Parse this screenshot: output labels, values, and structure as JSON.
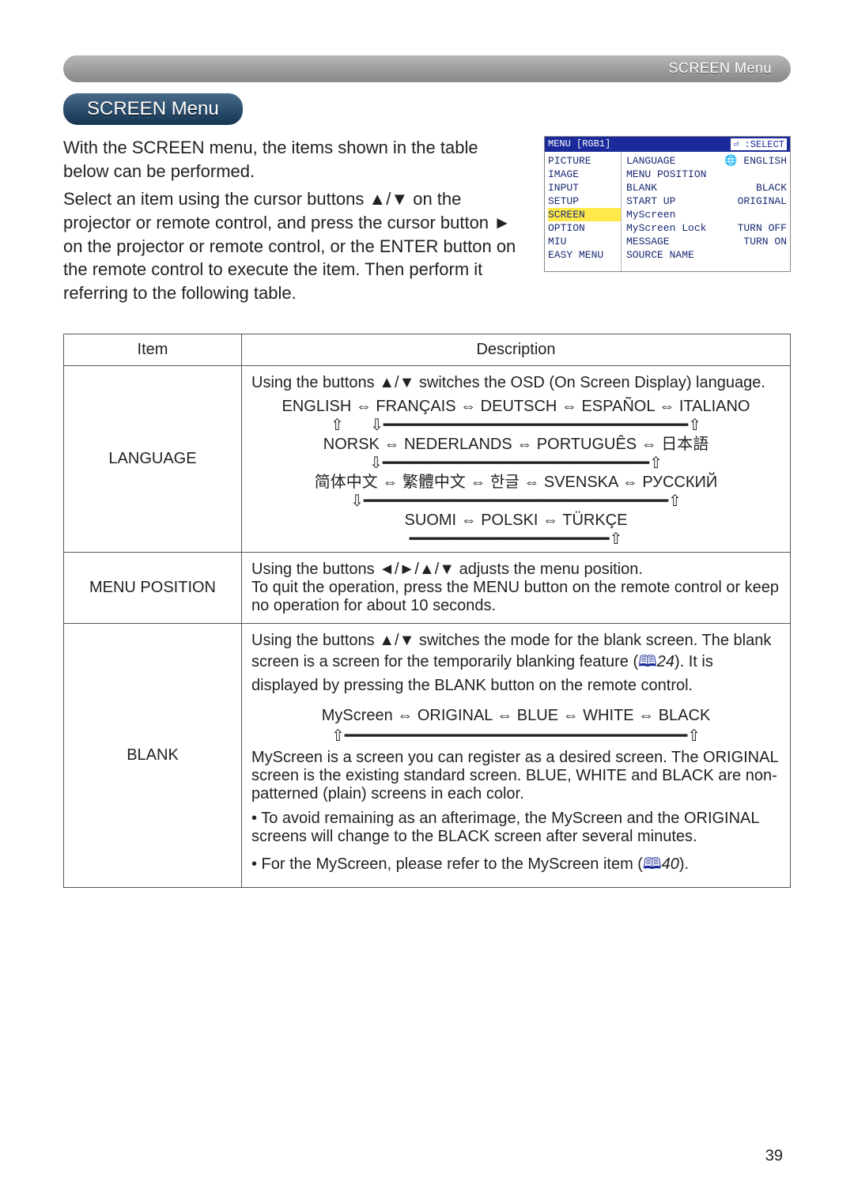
{
  "header": {
    "stripe_label": "SCREEN Menu",
    "title": "SCREEN Menu"
  },
  "intro": {
    "p1": "With the SCREEN menu, the items shown in the table below can be performed.",
    "p2": "Select an item using the cursor buttons ▲/▼ on the projector or remote control, and press the cursor button ► on the projector or remote control, or the ENTER button on the remote control to execute the item. Then perform it referring to the following table."
  },
  "osd": {
    "menu_label": "MENU [RGB1]",
    "select_label": ":SELECT",
    "left": [
      "PICTURE",
      "IMAGE",
      "INPUT",
      "SETUP",
      "SCREEN",
      "OPTION",
      "MIU",
      "EASY MENU"
    ],
    "highlight_index": 4,
    "right": [
      {
        "label": "LANGUAGE",
        "value": "ENGLISH",
        "globe": true
      },
      {
        "label": "MENU POSITION",
        "value": ""
      },
      {
        "label": "BLANK",
        "value": "BLACK"
      },
      {
        "label": "START UP",
        "value": "ORIGINAL"
      },
      {
        "label": "MyScreen",
        "value": ""
      },
      {
        "label": "MyScreen Lock",
        "value": "TURN OFF"
      },
      {
        "label": "MESSAGE",
        "value": "TURN ON"
      },
      {
        "label": "SOURCE NAME",
        "value": ""
      }
    ]
  },
  "table": {
    "head_item": "Item",
    "head_desc": "Description",
    "language": {
      "item": "LANGUAGE",
      "lead": "Using the buttons ▲/▼ switches the OSD (On Screen Display) language.",
      "line1": "ENGLISH ⇔ FRANÇAIS ⇔ DEUTSCH ⇔ ESPAÑOL ⇔ ITALIANO",
      "line2": "NORSK ⇔ NEDERLANDS ⇔ PORTUGUÊS ⇔ 日本語",
      "line3": "简体中文 ⇔ 繁體中文 ⇔ 한글 ⇔ SVENSKA ⇔ РУССКИЙ",
      "line4": "SUOMI ⇔ POLSKI ⇔ TÜRKÇE"
    },
    "menu_position": {
      "item": "MENU POSITION",
      "desc": "Using the buttons ◄/►/▲/▼ adjusts the menu position.\nTo quit the operation, press the MENU button on the remote control or keep no operation for about 10 seconds."
    },
    "blank": {
      "item": "BLANK",
      "p1a": "Using the buttons ▲/▼ switches the mode for the blank screen. The blank screen is a screen for the temporarily blanking feature (",
      "p1ref": "24",
      "p1b": "). It is displayed by pressing the BLANK button on the remote control.",
      "chain": "MyScreen ⇔ ORIGINAL ⇔ BLUE ⇔ WHITE ⇔ BLACK",
      "p2": "MyScreen is a screen you can register as a desired screen. The ORIGINAL screen is the existing standard screen. BLUE, WHITE and BLACK are non-patterned (plain) screens in each color.",
      "p3": "• To avoid remaining as an afterimage, the MyScreen and the ORIGINAL screens will change to the BLACK screen after several minutes.",
      "p4a": "• For the MyScreen, please refer to the MyScreen item (",
      "p4ref": "40",
      "p4b": ")."
    }
  },
  "page_number": "39"
}
